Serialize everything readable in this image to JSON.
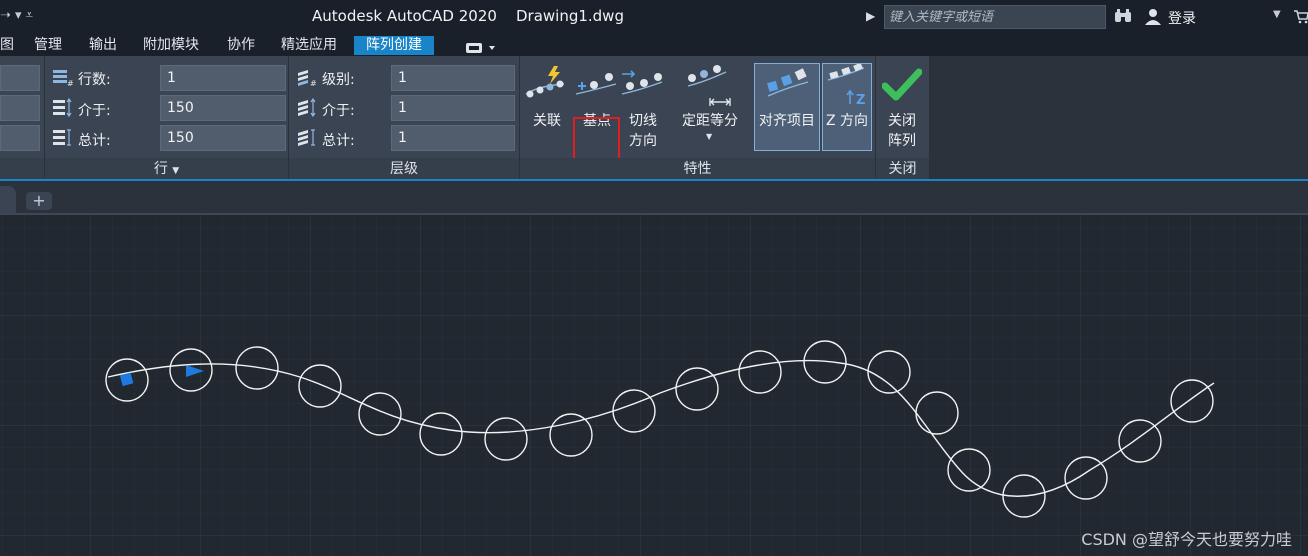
{
  "titlebar": {
    "app_title": "Autodesk AutoCAD 2020    Drawing1.dwg",
    "search_placeholder": "键入关键字或短语",
    "login_label": "登录"
  },
  "tabs": [
    {
      "label": "图"
    },
    {
      "label": "管理"
    },
    {
      "label": "输出"
    },
    {
      "label": "附加模块"
    },
    {
      "label": "协作"
    },
    {
      "label": "精选应用"
    },
    {
      "label": "阵列创建",
      "active": true
    }
  ],
  "ribbon": {
    "rows_panel": {
      "title": "行",
      "fields": [
        {
          "label": "行数:",
          "value": "1"
        },
        {
          "label": "介于:",
          "value": "150"
        },
        {
          "label": "总计:",
          "value": "150"
        }
      ]
    },
    "levels_panel": {
      "title": "层级",
      "fields": [
        {
          "label": "级别:",
          "value": "1"
        },
        {
          "label": "介于:",
          "value": "1"
        },
        {
          "label": "总计:",
          "value": "1"
        }
      ]
    },
    "properties_panel": {
      "title": "特性",
      "buttons": {
        "associative": "关联",
        "base_point": "基点",
        "tangent_line1": "切线",
        "tangent_line2": "方向",
        "measure": "定距等分",
        "align_items": "对齐项目",
        "z_direction": "Z 方向"
      }
    },
    "close_panel": {
      "title": "关闭",
      "close_line1": "关闭",
      "close_line2": "阵列"
    }
  },
  "watermark": "CSDN @望舒今天也要努力哇",
  "colors": {
    "accent": "#1a84c8",
    "highlight": "#e02020",
    "check": "#3dbf5c",
    "marker": "#1f7ae0"
  }
}
